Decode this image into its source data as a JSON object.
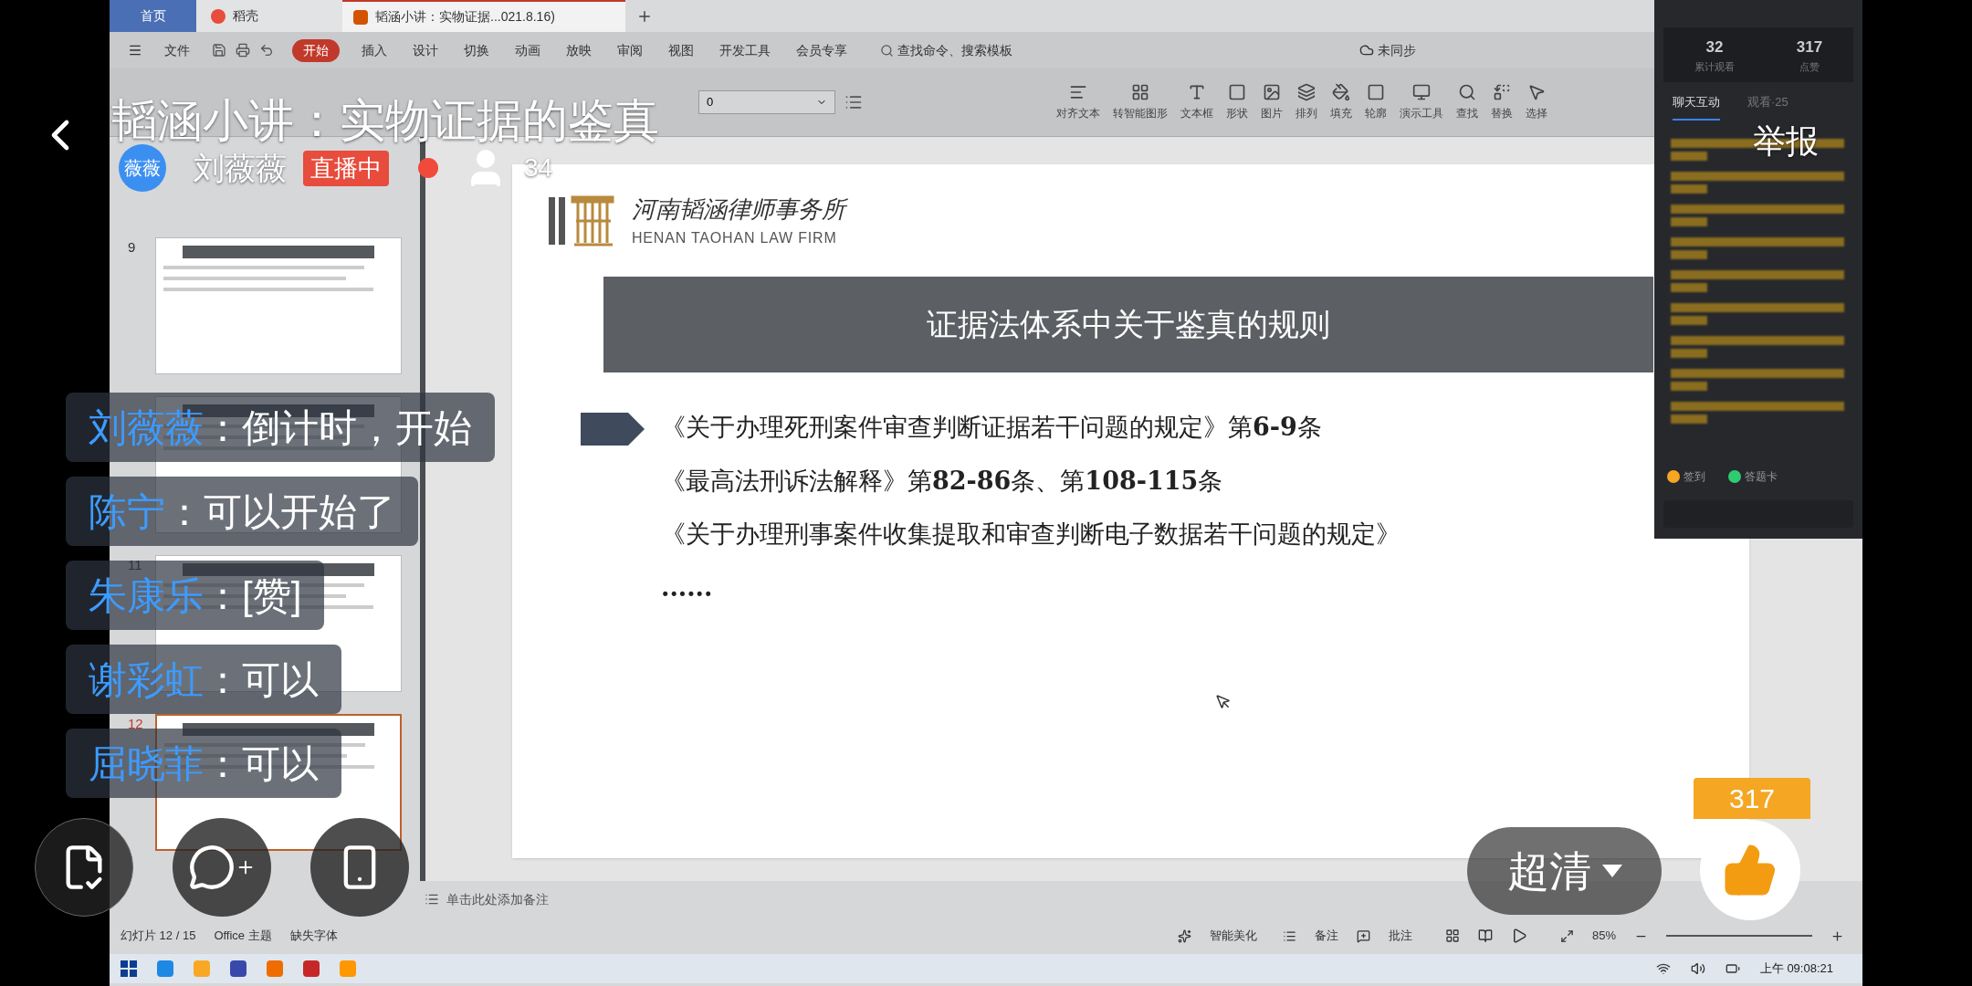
{
  "stream": {
    "title": "韬涵小讲：实物证据的鉴真",
    "host": {
      "avatar_text": "薇薇",
      "name": "刘薇薇",
      "badge": "直播中"
    },
    "viewers": "34",
    "report": "举报",
    "quality": "超清",
    "likes": "317"
  },
  "comments": [
    {
      "user": "刘薇薇",
      "separator": "：",
      "text": "倒计时，开始"
    },
    {
      "user": "陈宁",
      "separator": "：",
      "text": "可以开始了"
    },
    {
      "user": "朱康乐",
      "separator": "：",
      "text": "[赞]"
    },
    {
      "user": "谢彩虹",
      "separator": "：",
      "text": "可以"
    },
    {
      "user": "屈晓菲",
      "separator": "：",
      "text": "可以"
    }
  ],
  "wps": {
    "tabs": [
      {
        "label": "首页",
        "kind": "home",
        "selected": false
      },
      {
        "label": "稻壳",
        "kind": "app",
        "selected": false
      },
      {
        "label": "韬涵小讲：实物证据...021.8.16)",
        "kind": "doc",
        "selected": true
      }
    ],
    "menu": [
      {
        "label": "文件",
        "selected": false
      },
      {
        "label": "开始",
        "selected": true
      },
      {
        "label": "插入",
        "selected": false
      },
      {
        "label": "设计",
        "selected": false
      },
      {
        "label": "切换",
        "selected": false
      },
      {
        "label": "动画",
        "selected": false
      },
      {
        "label": "放映",
        "selected": false
      },
      {
        "label": "审阅",
        "selected": false
      },
      {
        "label": "视图",
        "selected": false
      },
      {
        "label": "开发工具",
        "selected": false
      },
      {
        "label": "会员专享",
        "selected": false
      }
    ],
    "search": "查找命令、搜索模板",
    "sync": "未同步",
    "font_size": "0",
    "toolbar": [
      "对齐文本",
      "转智能图形",
      "文本框",
      "形状",
      "图片",
      "排列",
      "填充",
      "轮廓",
      "演示工具",
      "查找",
      "替换",
      "选择"
    ],
    "thumbnails": [
      {
        "number": "9",
        "selected": false
      },
      {
        "selected": false
      },
      {
        "number": "11",
        "selected": false
      },
      {
        "number": "12",
        "selected": true
      }
    ],
    "slide": {
      "firm_name": "河南韬涵律师事务所",
      "firm_name_en": "HENAN TAOHAN LAW FIRM",
      "heading": "证据法体系中关于鉴真的规则",
      "rules": [
        "《关于办理死刑案件审查判断证据若干问题的规定》第**6-9**条",
        "《最高法刑诉法解释》第**82-86**条、第**108-115**条",
        "《关于办理刑事案件收集提取和审查判断电子数据若干问题的规定》"
      ],
      "ellipsis": "......"
    },
    "notes_placeholder": "单击此处添加备注",
    "status": {
      "slide_count": "幻灯片 12 / 15",
      "theme": "Office 主题",
      "missing_font": "缺失字体",
      "beautify": "智能美化",
      "notes": "备注",
      "comments": "批注",
      "zoom": "85%"
    }
  },
  "live_panel": {
    "stats": [
      {
        "value": "32",
        "label": "累计观看"
      },
      {
        "value": "317",
        "label": "点赞"
      }
    ],
    "tabs": [
      {
        "label": "聊天互动",
        "selected": true
      },
      {
        "label": "观看·25",
        "selected": false
      }
    ],
    "actions": [
      {
        "label": "签到",
        "color": "#f5a623"
      },
      {
        "label": "答题卡",
        "color": "#2ecc71"
      }
    ]
  },
  "taskbar": {
    "clock": "上午 09:08:21"
  }
}
